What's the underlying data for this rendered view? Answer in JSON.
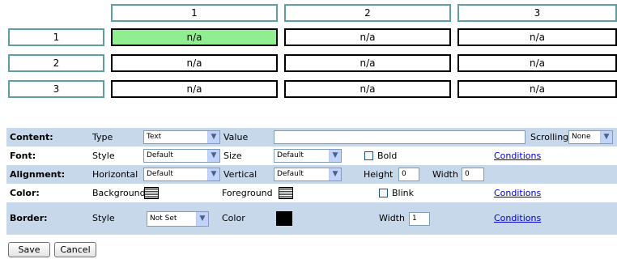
{
  "grid": {
    "col_headers": [
      "1",
      "2",
      "3"
    ],
    "rows": [
      {
        "label": "1",
        "cells": [
          "n/a",
          "n/a",
          "n/a"
        ]
      },
      {
        "label": "2",
        "cells": [
          "n/a",
          "n/a",
          "n/a"
        ]
      },
      {
        "label": "3",
        "cells": [
          "n/a",
          "n/a",
          "n/a"
        ]
      }
    ],
    "selected_color": "#90ee90",
    "header_border_color": "#5f9ea0"
  },
  "panel": {
    "row_color_blue": "#c7d8ea",
    "content": {
      "label": "Content:",
      "type_label": "Type",
      "type_value": "Text",
      "value_label": "Value",
      "value_text": "",
      "scrolling_label": "Scrolling",
      "scrolling_value": "None"
    },
    "font": {
      "label": "Font:",
      "style_label": "Style",
      "style_value": "Default",
      "size_label": "Size",
      "size_value": "Default",
      "bold_label": "Bold",
      "bold_checked": false,
      "conditions": "Conditions"
    },
    "alignment": {
      "label": "Alignment:",
      "horizontal_label": "Horizontal",
      "horizontal_value": "Default",
      "vertical_label": "Vertical",
      "vertical_value": "Default",
      "height_label": "Height",
      "height_value": "0",
      "width_label": "Width",
      "width_value": "0"
    },
    "color": {
      "label": "Color:",
      "background_label": "Background",
      "foreground_label": "Foreground",
      "blink_label": "Blink",
      "blink_checked": false,
      "conditions": "Conditions"
    },
    "border": {
      "label": "Border:",
      "style_label": "Style",
      "style_value": "Not Set",
      "color_label": "Color",
      "color_value": "#000000",
      "width_label": "Width",
      "width_value": "1",
      "conditions": "Conditions"
    }
  },
  "buttons": {
    "save": "Save",
    "cancel": "Cancel"
  }
}
